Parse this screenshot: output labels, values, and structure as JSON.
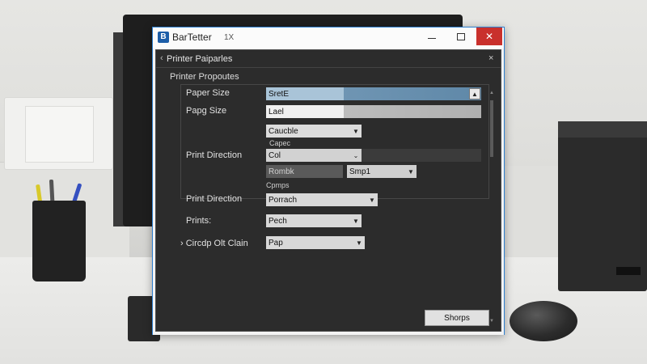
{
  "window": {
    "app_icon_letter": "B",
    "title": "BarTetter",
    "version": "1X",
    "minimize_icon": "minimize-icon",
    "maximize_icon": "maximize-icon",
    "close_icon": "close-icon",
    "close_glyph": "✕",
    "close_color": "#c9302c",
    "accent_border": "#2d7fd0"
  },
  "dialog": {
    "back_glyph": "‹",
    "title": "Printer Paiparles",
    "close_glyph": "×"
  },
  "section": {
    "title": "Printer Propoutes"
  },
  "rows": {
    "paper_size_1": {
      "label": "Paper Size",
      "value": "SretE",
      "caret": "▲"
    },
    "paper_size_2": {
      "label": "Papg Size",
      "value": "Lael"
    },
    "cascade": {
      "caption": "Caucble",
      "caret": "▼"
    },
    "cases_caption": "Capec",
    "print_direction_1": {
      "label": "Print Direction",
      "value": "Col",
      "caret": "⌄"
    },
    "rombk": {
      "value": "Rombk"
    },
    "smpl": {
      "value": "Smp1",
      "caret": "▼"
    },
    "options_caption": "Cpmps",
    "print_direction_2": {
      "label": "Print Direction",
      "value": "Porrach",
      "caret": "▼"
    },
    "prints": {
      "label": "Prints:",
      "value": "Pech",
      "caret": "▼"
    },
    "cross": {
      "label": "› Circdp Olt Clain",
      "value": "Pap",
      "caret": "▼"
    }
  },
  "footer": {
    "apply_label": "Shorps"
  }
}
